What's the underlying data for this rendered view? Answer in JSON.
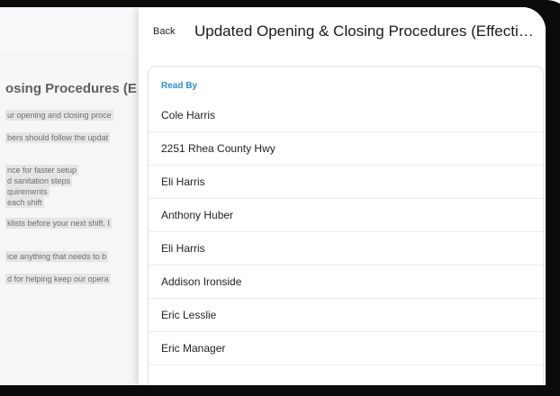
{
  "background_page": {
    "title": "osing Procedures (E",
    "lines": [
      "ur opening and closing proce",
      "bers should follow the updat",
      "nce for faster setup",
      "d sanitation steps",
      "quirements",
      "each shift",
      "klists before your next shift. I",
      "ice anything that needs to b",
      "d for helping keep our opera"
    ]
  },
  "sheet": {
    "back_label": "Back",
    "title": "Updated Opening & Closing Procedures (Effective Immediately)",
    "card": {
      "header": "Read By",
      "items": [
        "Cole Harris",
        "2251 Rhea County Hwy",
        "Eli Harris",
        "Anthony Huber",
        "Eli Harris",
        "Addison Ironside",
        "Eric Lesslie",
        "Eric Manager"
      ]
    }
  },
  "colors": {
    "accent": "#2b8fd1",
    "frame": "#0b0b0b"
  }
}
